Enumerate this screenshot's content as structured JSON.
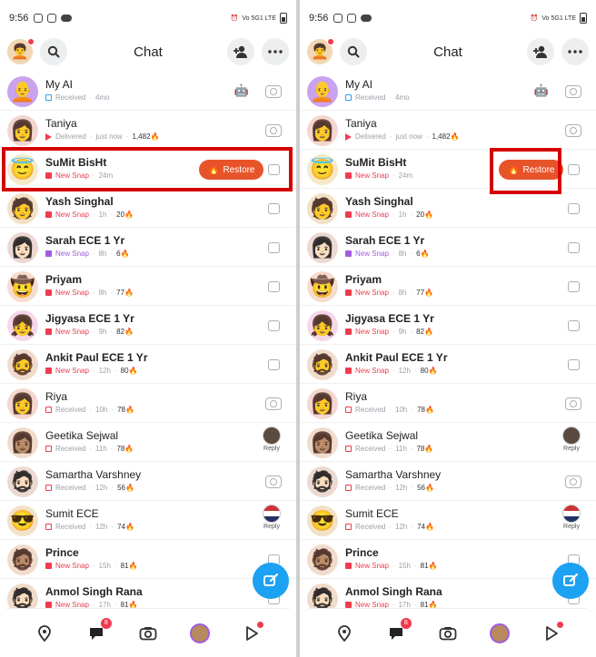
{
  "status_bar": {
    "time": "9:56",
    "network": "Vo 5G1 LTE"
  },
  "header": {
    "title": "Chat"
  },
  "restore_label": "Restore",
  "reply_label": "Reply",
  "nav": {
    "chat_badge": "8"
  },
  "chats": [
    {
      "name": "My AI",
      "status": "Received",
      "time": "4mo",
      "streak": "",
      "kind": "received-blue",
      "right": "camera",
      "robot": true,
      "avatar": "🧑‍🦲",
      "avatar_bg": "#c9a3f0"
    },
    {
      "name": "Taniya",
      "status": "Delivered",
      "time": "just now",
      "streak": "1,482🔥",
      "kind": "delivered",
      "right": "camera",
      "avatar": "👩",
      "avatar_bg": "#f4d6cf"
    },
    {
      "name": "SuMit BisHt",
      "status": "New Snap",
      "time": "24m",
      "streak": "",
      "kind": "new-red",
      "right": "chat",
      "restore": true,
      "avatar": "😇",
      "avatar_bg": "#f5e9c9"
    },
    {
      "name": "Yash Singhal",
      "status": "New Snap",
      "time": "1h",
      "streak": "20🔥",
      "kind": "new-red",
      "right": "chat",
      "avatar": "🧑",
      "avatar_bg": "#f3e1c6"
    },
    {
      "name": "Sarah ECE 1 Yr",
      "status": "New Snap",
      "time": "8h",
      "streak": "6🔥",
      "kind": "new-purple",
      "right": "chat",
      "avatar": "👩🏻",
      "avatar_bg": "#ecd9d2"
    },
    {
      "name": "Priyam",
      "status": "New Snap",
      "time": "8h",
      "streak": "77🔥",
      "kind": "new-red",
      "right": "chat",
      "avatar": "🤠",
      "avatar_bg": "#f6dccc"
    },
    {
      "name": "Jigyasa ECE 1 Yr",
      "status": "New Snap",
      "time": "9h",
      "streak": "82🔥",
      "kind": "new-red",
      "right": "chat",
      "avatar": "👧",
      "avatar_bg": "#f6d7ea"
    },
    {
      "name": "Ankit Paul ECE 1 Yr",
      "status": "New Snap",
      "time": "12h",
      "streak": "80🔥",
      "kind": "new-red",
      "right": "chat",
      "avatar": "🧔",
      "avatar_bg": "#f1dccc"
    },
    {
      "name": "Riya",
      "status": "Received",
      "time": "10h",
      "streak": "78🔥",
      "kind": "received-red",
      "right": "camera",
      "avatar": "👩",
      "avatar_bg": "#f4d6cf"
    },
    {
      "name": "Geetika Sejwal",
      "status": "Received",
      "time": "11h",
      "streak": "78🔥",
      "kind": "received-red",
      "right": "reply",
      "avatar": "👩🏽",
      "avatar_bg": "#f1dccc"
    },
    {
      "name": "Samartha Varshney",
      "status": "Received",
      "time": "12h",
      "streak": "56🔥",
      "kind": "received-red",
      "right": "camera",
      "avatar": "🧔🏻",
      "avatar_bg": "#ecd9d2"
    },
    {
      "name": "Sumit ECE",
      "status": "Received",
      "time": "12h",
      "streak": "74🔥",
      "kind": "received-red",
      "right": "reply-flag",
      "avatar": "😎",
      "avatar_bg": "#f3e1c6"
    },
    {
      "name": "Prince",
      "status": "New Snap",
      "time": "15h",
      "streak": "81🔥",
      "kind": "new-red",
      "right": "chat",
      "avatar": "🧔🏽",
      "avatar_bg": "#f1dccc"
    },
    {
      "name": "Anmol Singh Rana",
      "status": "New Snap",
      "time": "17h",
      "streak": "81🔥",
      "kind": "new-red",
      "right": "chat",
      "avatar": "🧔🏻",
      "avatar_bg": "#f1dccc"
    }
  ]
}
